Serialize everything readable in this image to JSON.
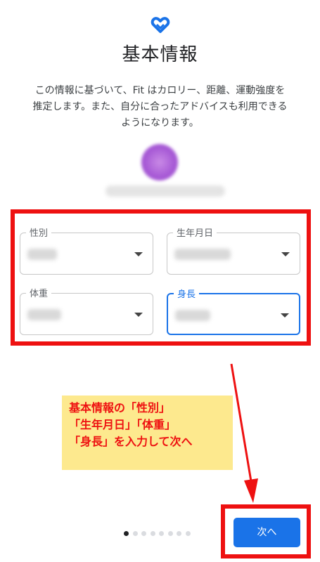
{
  "header": {
    "title": "基本情報",
    "description": [
      "この情報に基づいて、Fit はカロリー、距離、運動強度を",
      "推定します。また、自分に合ったアドバイスも利用できる",
      "ようになります。"
    ]
  },
  "form": {
    "fields": [
      {
        "label": "性別",
        "icon": "chevron-down-icon"
      },
      {
        "label": "生年月日",
        "icon": "chevron-down-icon"
      },
      {
        "label": "体重",
        "icon": "chevron-down-icon"
      },
      {
        "label": "身長",
        "icon": "chevron-down-icon",
        "state": "focused"
      }
    ]
  },
  "annotation": {
    "note_lines": [
      "基本情報の「性別」",
      "「生年月日」「体重」",
      "「身長」を入力して次へ"
    ]
  },
  "footer": {
    "page_index": 1,
    "page_count": 8,
    "next_label": "次へ"
  },
  "colors": {
    "accent": "#1a73e8",
    "highlight": "#ee1111",
    "note_background": "#fde98e"
  }
}
